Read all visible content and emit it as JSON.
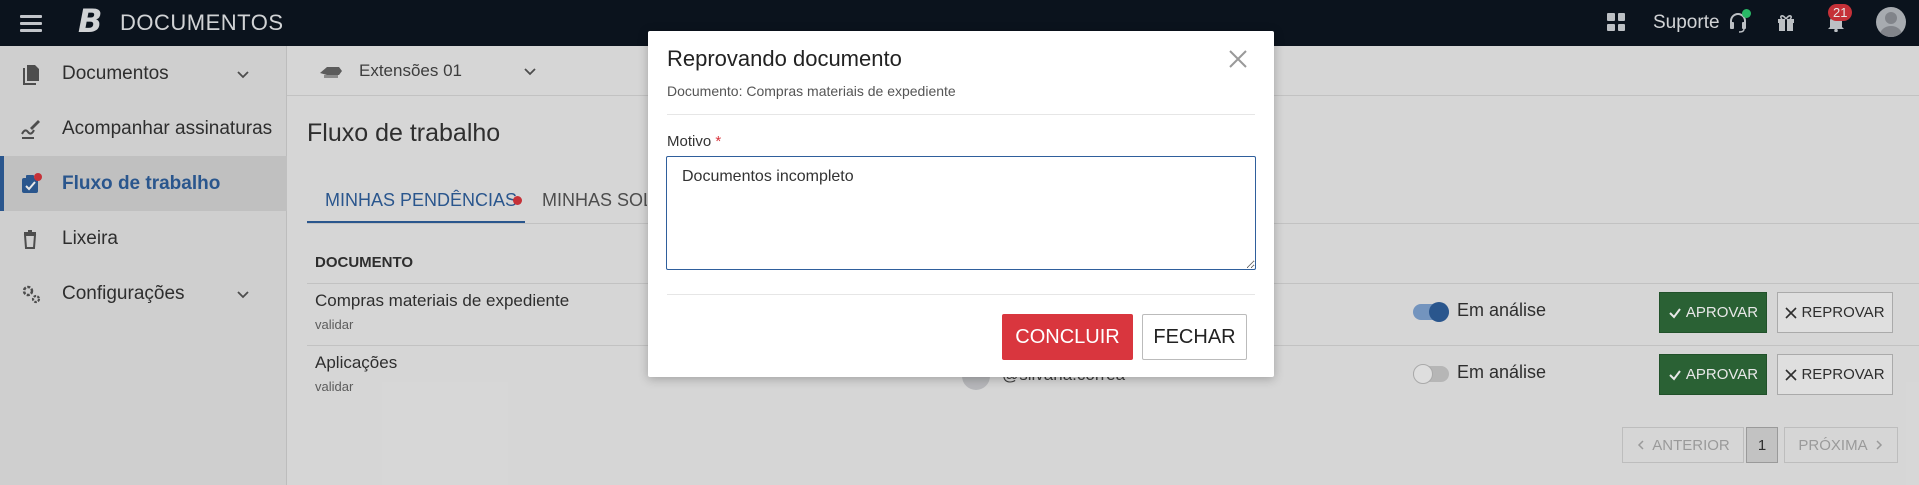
{
  "topbar": {
    "brand_letter": "B",
    "brand_name": "DOCUMENTOS",
    "support_label": "Suporte",
    "notifications_count": "21",
    "status_dot_color": "#2ecc71",
    "badge_color": "#d9363e"
  },
  "sidebar": {
    "items": [
      {
        "label": "Documentos",
        "icon": "documents-icon",
        "expandable": true
      },
      {
        "label": "Acompanhar assinaturas",
        "icon": "signature-icon"
      },
      {
        "label": "Fluxo de trabalho",
        "icon": "workflow-icon",
        "active": true
      },
      {
        "label": "Lixeira",
        "icon": "trash-icon"
      },
      {
        "label": "Configurações",
        "icon": "settings-icon",
        "expandable": true
      }
    ],
    "active_color": "#2f5f9c"
  },
  "main": {
    "extension_select": "Extensões 01",
    "page_title": "Fluxo de trabalho",
    "tabs": [
      {
        "label": "MINHAS PENDÊNCIAS",
        "active": true
      },
      {
        "label": "MINHAS SOLICITAÇÕES"
      }
    ],
    "table": {
      "header_document": "DOCUMENTO",
      "rows": [
        {
          "title": "Compras materiais de expediente",
          "subtitle": "validar",
          "status": "Em análise",
          "toggle_on": true
        },
        {
          "title": "Aplicações",
          "subtitle": "validar",
          "user": "@silvana.correa",
          "status": "Em análise",
          "toggle_on": false
        }
      ],
      "approve_label": "APROVAR",
      "reject_label": "REPROVAR"
    },
    "pagination": {
      "prev": "ANTERIOR",
      "current": "1",
      "next": "PRÓXIMA"
    }
  },
  "modal": {
    "title": "Reprovando documento",
    "subtitle": "Documento: Compras materiais de expediente",
    "field_label": "Motivo",
    "required_mark": "*",
    "textarea_value": "Documentos incompleto",
    "confirm_label": "CONCLUIR",
    "close_label": "FECHAR",
    "confirm_color": "#d9363e"
  }
}
